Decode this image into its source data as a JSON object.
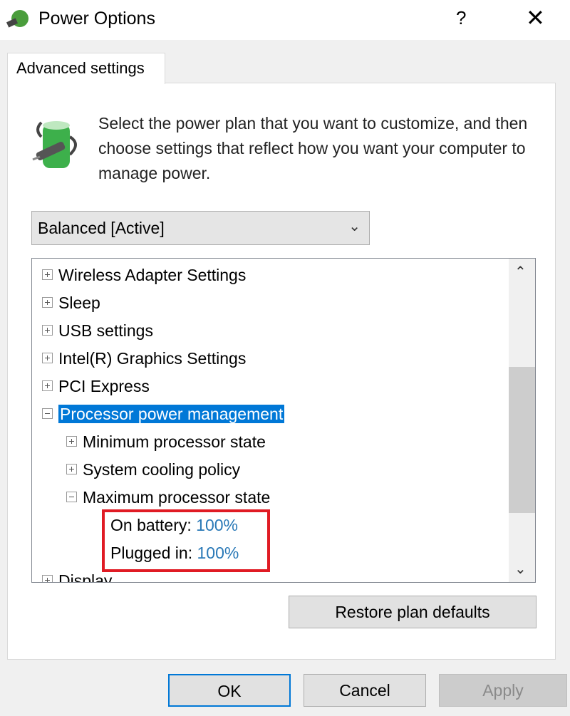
{
  "window": {
    "title": "Power Options",
    "help": "?",
    "close": "✕"
  },
  "tab": {
    "label": "Advanced settings"
  },
  "description": "Select the power plan that you want to customize, and then choose settings that reflect how you want your computer to manage power.",
  "plan_select": {
    "value": "Balanced [Active]"
  },
  "tree": [
    {
      "label": "Wireless Adapter Settings",
      "state": "collapsed",
      "level": 0
    },
    {
      "label": "Sleep",
      "state": "collapsed",
      "level": 0
    },
    {
      "label": "USB settings",
      "state": "collapsed",
      "level": 0
    },
    {
      "label": "Intel(R) Graphics Settings",
      "state": "collapsed",
      "level": 0
    },
    {
      "label": "PCI Express",
      "state": "collapsed",
      "level": 0
    },
    {
      "label": "Processor power management",
      "state": "expanded",
      "level": 0,
      "selected": true
    },
    {
      "label": "Minimum processor state",
      "state": "collapsed",
      "level": 1
    },
    {
      "label": "System cooling policy",
      "state": "collapsed",
      "level": 1
    },
    {
      "label": "Maximum processor state",
      "state": "expanded",
      "level": 1
    },
    {
      "label": "Display",
      "state": "collapsed",
      "level": 0
    }
  ],
  "max_state": {
    "on_battery_label": "On battery:",
    "on_battery_value": "100%",
    "plugged_in_label": "Plugged in:",
    "plugged_in_value": "100%"
  },
  "buttons": {
    "restore": "Restore plan defaults",
    "ok": "OK",
    "cancel": "Cancel",
    "apply": "Apply"
  },
  "colors": {
    "selection": "#0078d7",
    "highlight_box": "#e01b24",
    "value_link": "#2a79b7"
  }
}
